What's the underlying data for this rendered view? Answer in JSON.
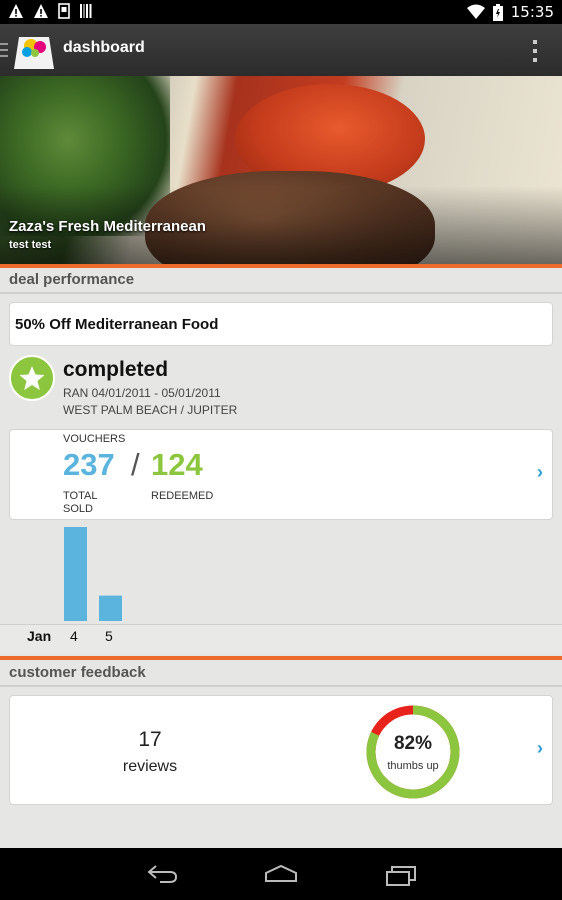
{
  "status_bar": {
    "time": "15:35"
  },
  "action_bar": {
    "title": "dashboard"
  },
  "hero": {
    "business_name": "Zaza's Fresh Mediterranean",
    "subtitle": "test test"
  },
  "deal_performance": {
    "heading": "deal performance",
    "deal_title": "50% Off Mediterranean Food",
    "status": "completed",
    "ran": "RAN 04/01/2011 - 05/01/2011",
    "location": "WEST PALM BEACH / JUPITER",
    "vouchers": {
      "label": "VOUCHERS",
      "total_sold": "237",
      "separator": "/",
      "redeemed": "124",
      "total_sold_label": "TOTAL SOLD",
      "redeemed_label": "REDEEMED"
    },
    "chart_data": {
      "type": "bar",
      "month_label": "Jan",
      "categories": [
        "4",
        "5"
      ],
      "values": [
        100,
        27
      ],
      "color": "#5ab4de"
    }
  },
  "customer_feedback": {
    "heading": "customer feedback",
    "review_count": "17",
    "review_label": "reviews",
    "thumbs_up_percent": "82%",
    "thumbs_up_fraction": 0.82,
    "thumbs_up_label": "thumbs up",
    "colors": {
      "positive": "#8cc63f",
      "negative": "#e8231b"
    }
  },
  "icons": [
    "warning-icon",
    "warning-icon",
    "sim-icon",
    "barcode-icon",
    "wifi-icon",
    "battery-icon",
    "drawer-icon",
    "app-logo-icon",
    "overflow-menu-icon",
    "star-icon",
    "chevron-right-icon",
    "back-icon",
    "home-icon",
    "recent-apps-icon"
  ]
}
